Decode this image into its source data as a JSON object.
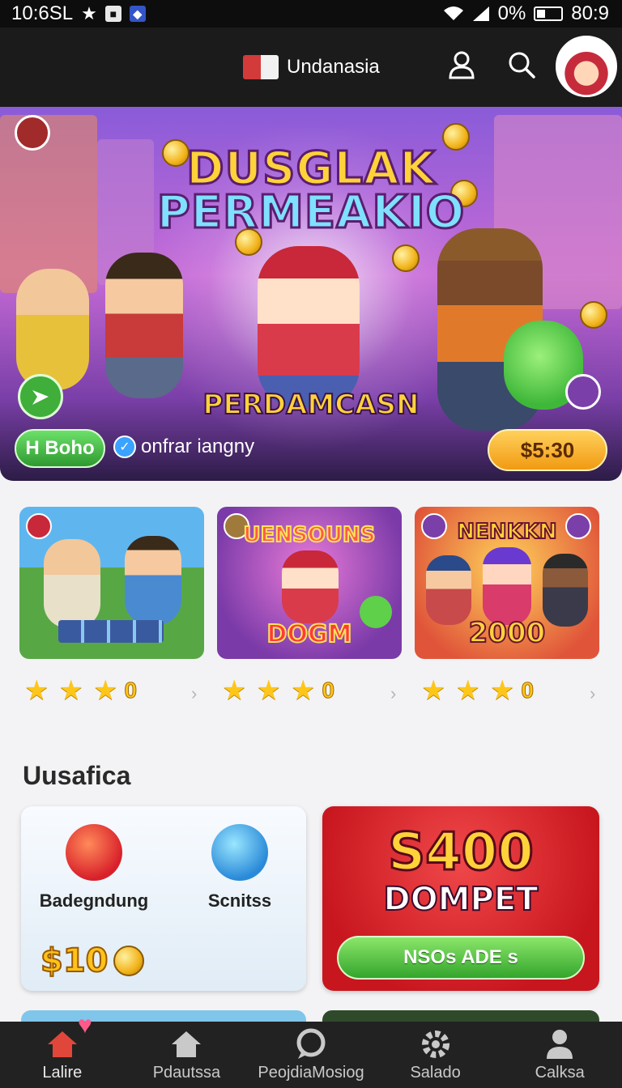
{
  "status_bar": {
    "time": "10:6SL",
    "battery_text": "0%",
    "clock_right": "80:9",
    "icons": [
      "star-icon",
      "notification-icon",
      "app-icon",
      "wifi-icon",
      "signal-icon",
      "battery-icon"
    ]
  },
  "header": {
    "brand": "Undanasia",
    "icons": [
      "book-logo-icon",
      "profile-icon",
      "search-icon",
      "avatar"
    ]
  },
  "hero": {
    "title_line1": "DUSGLAK",
    "title_line2": "PERMEAKIO",
    "subtitle": "PERDAMCASN",
    "tag": "H Boho",
    "verified_text": "onfrar iangny",
    "price": "$5:30"
  },
  "games": [
    {
      "title": "",
      "rating": "0"
    },
    {
      "title": "UENSOUNS",
      "bottom": "DOGM",
      "rating": "0"
    },
    {
      "title": "NENKKN",
      "bottom": "2000",
      "rating": "0"
    }
  ],
  "section": {
    "title": "Uusafica",
    "promo_left": {
      "item1": "Badegndung",
      "item2": "Scnitss",
      "price": "$10"
    },
    "promo_right": {
      "amount": "S400",
      "label": "DOMPET",
      "button": "NSOs ADE s"
    }
  },
  "bottom_nav": [
    {
      "label": "Lalire",
      "icon": "home-icon",
      "active": true
    },
    {
      "label": "Pdautssa",
      "icon": "house-icon",
      "active": false
    },
    {
      "label": "PeojdiaMosiog",
      "icon": "chat-icon",
      "active": false
    },
    {
      "label": "Salado",
      "icon": "gear-icon",
      "active": false
    },
    {
      "label": "Calksa",
      "icon": "user-icon",
      "active": false
    }
  ],
  "colors": {
    "accent_gold": "#ffc61a",
    "promo_red": "#c8161e",
    "button_green": "#34a52c",
    "nav_active": "#e0473a"
  }
}
